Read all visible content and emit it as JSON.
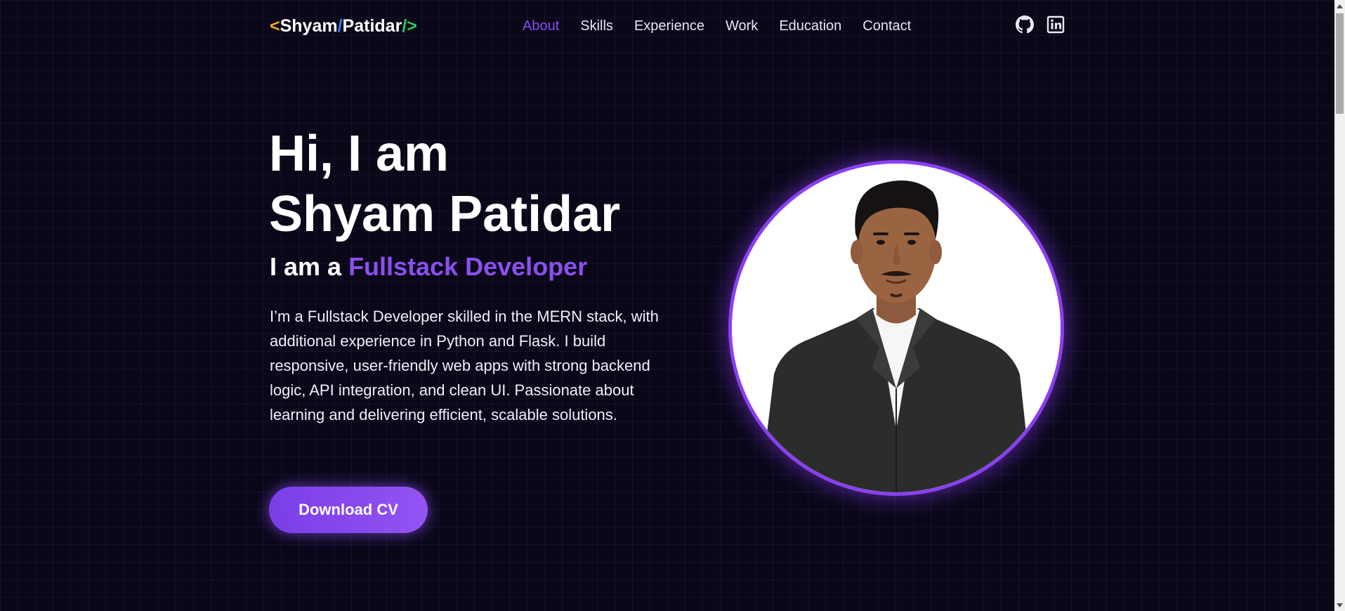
{
  "nav": {
    "logo": {
      "open": "<",
      "first": "Shyam",
      "slash": "/",
      "last": "Patidar",
      "end": "/>"
    },
    "items": [
      {
        "label": "About",
        "active": true
      },
      {
        "label": "Skills",
        "active": false
      },
      {
        "label": "Experience",
        "active": false
      },
      {
        "label": "Work",
        "active": false
      },
      {
        "label": "Education",
        "active": false
      },
      {
        "label": "Contact",
        "active": false
      }
    ],
    "social": [
      {
        "icon": "github-icon"
      },
      {
        "icon": "linkedin-icon"
      }
    ]
  },
  "hero": {
    "greeting": "Hi, I am",
    "name": "Shyam Patidar",
    "role_prefix": "I am a ",
    "role": "Fullstack Developer",
    "bio": "I’m a Fullstack Developer skilled in the MERN stack, with additional experience in Python and Flask. I build responsive, user-friendly web apps with strong backend logic, API integration, and clean UI. Passionate about learning and delivering efficient, scalable solutions.",
    "cv_button": "Download CV"
  },
  "colors": {
    "background": "#0a0719",
    "accent": "#8a4af3",
    "logo_lt": "#f5a524",
    "logo_slash": "#2f7ef6",
    "logo_end": "#27c964"
  }
}
